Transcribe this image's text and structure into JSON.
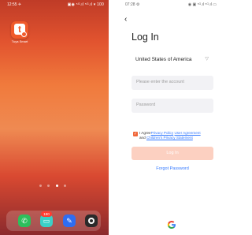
{
  "home": {
    "status": {
      "time": "12:55 ✈",
      "icons": "▣◉ ⁵ᴳ.ıl ⁵ᴳ.ıl ▾ 100"
    },
    "app": {
      "name": "Tuya",
      "label": "Tuya Smart"
    },
    "dock": {
      "badge": "190"
    }
  },
  "login": {
    "status": {
      "time": "07:28 ⚙",
      "icons": "◉ ▣ ⁵ᴳ.ıl ⁵ᴳ.ıl ▭"
    },
    "back_icon": "‹",
    "title": "Log In",
    "country": "United States of America",
    "country_chevron": "▽",
    "account_placeholder": "Please enter the account",
    "password_placeholder": "Password",
    "agree": {
      "prefix": "I Agree",
      "privacy": "Privacy Policy",
      "user": "User Agreement",
      "and": "and",
      "children": "Children's Privacy Statement"
    },
    "login_button": "Log In",
    "forgot": "Forgot Password"
  },
  "colors": {
    "accent": "#f0673a",
    "link": "#3479ff",
    "button_disabled": "#fcd0c1"
  }
}
